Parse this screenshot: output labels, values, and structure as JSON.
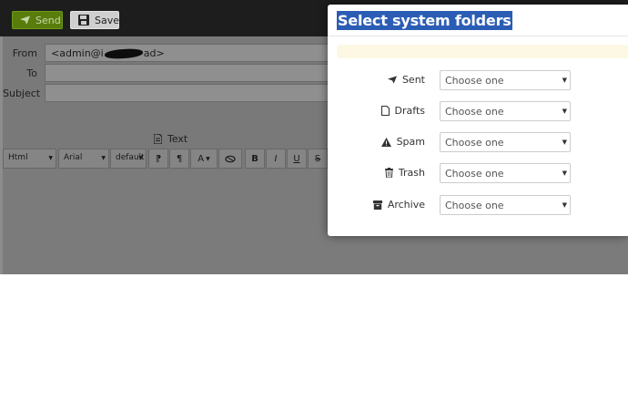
{
  "toolbar": {
    "send_label": "Send",
    "save_label": "Save",
    "send_icon": "paper-plane-icon",
    "save_icon": "floppy-disk-icon"
  },
  "compose": {
    "from_label": "From",
    "from_value_prefix": "<admin@i",
    "from_value_suffix": "ad>",
    "to_label": "To",
    "to_value": "",
    "subject_label": "Subject",
    "subject_value": "",
    "text_tab_label": "Text",
    "editor": {
      "format_select": "Html",
      "font_select": "Arial",
      "size_select": "default",
      "buttons": [
        "⁋",
        "¶",
        "A",
        "B",
        "I",
        "U",
        "S"
      ]
    }
  },
  "dialog": {
    "title": "Select system folders",
    "rows": [
      {
        "label": "Sent",
        "icon": "paper-plane-icon",
        "value": "Choose one"
      },
      {
        "label": "Drafts",
        "icon": "file-icon",
        "value": "Choose one"
      },
      {
        "label": "Spam",
        "icon": "warning-icon",
        "value": "Choose one"
      },
      {
        "label": "Trash",
        "icon": "trash-icon",
        "value": "Choose one"
      },
      {
        "label": "Archive",
        "icon": "archive-icon",
        "value": "Choose one"
      }
    ]
  },
  "colors": {
    "send_button": "#587d0c",
    "title_highlight": "#2b5db5",
    "alert_background": "#fcf8e3"
  }
}
